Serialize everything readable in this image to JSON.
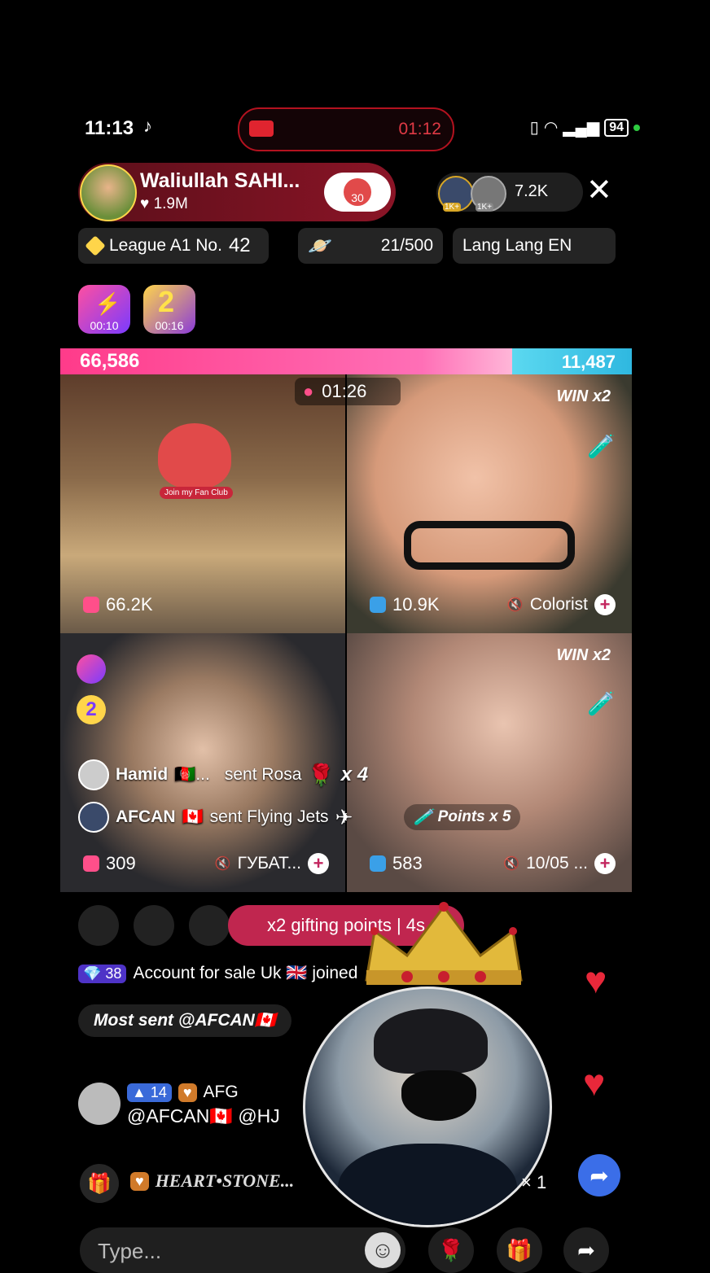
{
  "status_bar": {
    "time": "11:13",
    "recording_time": "01:12",
    "battery": "94"
  },
  "host": {
    "name": "Waliullah SAHI...",
    "likes": "1.9M",
    "fan_badge": "30"
  },
  "viewers": {
    "badge1": "1K+",
    "badge2": "1K+",
    "count": "7.2K"
  },
  "chips": {
    "league_prefix": "League A1 No.",
    "league_num": "42",
    "progress": "21/500",
    "lang": "Lang Lang EN"
  },
  "timers": [
    {
      "label": "00:10"
    },
    {
      "label": "00:16"
    }
  ],
  "battle": {
    "left_score": "66,586",
    "right_score": "11,487",
    "left_share": 0.79,
    "match_timer": "01:26"
  },
  "cells": [
    {
      "count": "66.2K",
      "fan_club": "Join my Fan Club"
    },
    {
      "count": "10.9K",
      "win": "WIN x2",
      "name": "Colorist"
    },
    {
      "count": "309",
      "name": "ГУБАТ..."
    },
    {
      "count": "583",
      "win": "WIN x2",
      "name": "10/05 ..."
    }
  ],
  "gift_msgs": [
    {
      "user": "Hamid",
      "user_suffix": "🇦🇫...",
      "text": "sent Rosa",
      "count": "x 4"
    },
    {
      "user": "AFCAN",
      "user_suffix": "🇨🇦",
      "text": "sent Flying Jets"
    }
  ],
  "points_msg": "Points x 5",
  "gifting_points": "x2 gifting points | 4s",
  "comments": {
    "join": {
      "level": "38",
      "text": "Account for sale Uk 🇬🇧 joined"
    },
    "most_sent": "Most sent @AFCAN🇨🇦",
    "chat": {
      "level": "14",
      "user": "AFG",
      "text": "@AFCAN🇨🇦 @HJ"
    }
  },
  "gift_bar": {
    "name": "HEART•STONE...",
    "count": "× 1"
  },
  "input": {
    "placeholder": "Type..."
  },
  "colors": {
    "accent_pink": "#ff3b8a",
    "accent_blue": "#2fb8e0",
    "heart_red": "#e8283a"
  }
}
